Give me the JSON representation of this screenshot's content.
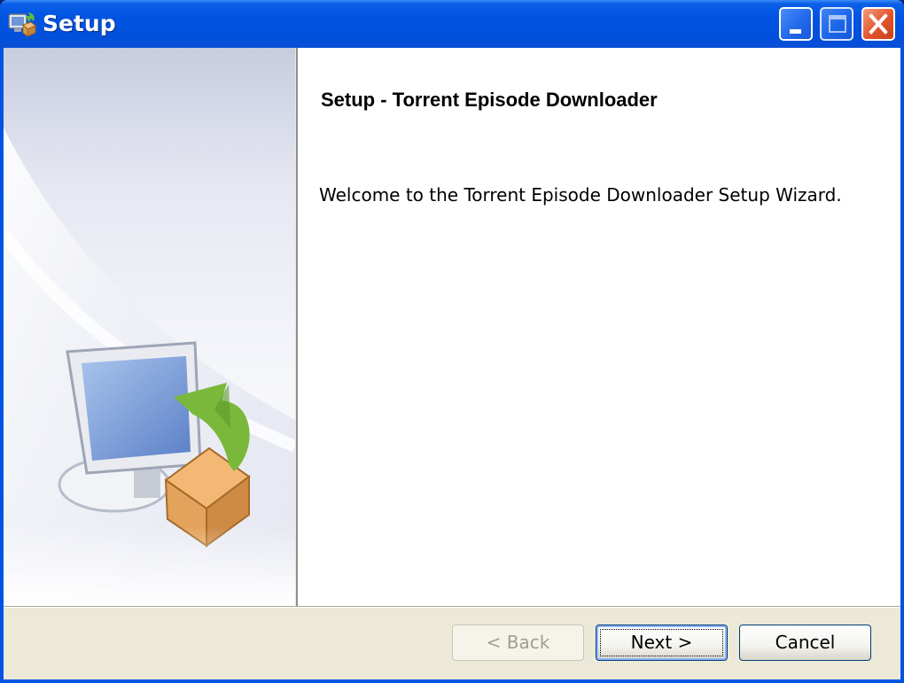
{
  "window": {
    "title": "Setup",
    "icon": "setup-installer-icon",
    "controls": {
      "minimize": "minimize-icon",
      "maximize": "maximize-icon",
      "close": "close-icon"
    }
  },
  "wizard": {
    "heading": "Setup - Torrent Episode Downloader",
    "welcome_text": "Welcome to the Torrent Episode Downloader Setup Wizard.",
    "side_image": "computer-with-package-install-graphic"
  },
  "buttons": {
    "back_label": "< Back",
    "back_enabled": false,
    "next_label": "Next >",
    "cancel_label": "Cancel"
  },
  "colors": {
    "titlebar": "#0054e3",
    "dialog_face": "#ece9d8",
    "close_button": "#e2542e"
  }
}
